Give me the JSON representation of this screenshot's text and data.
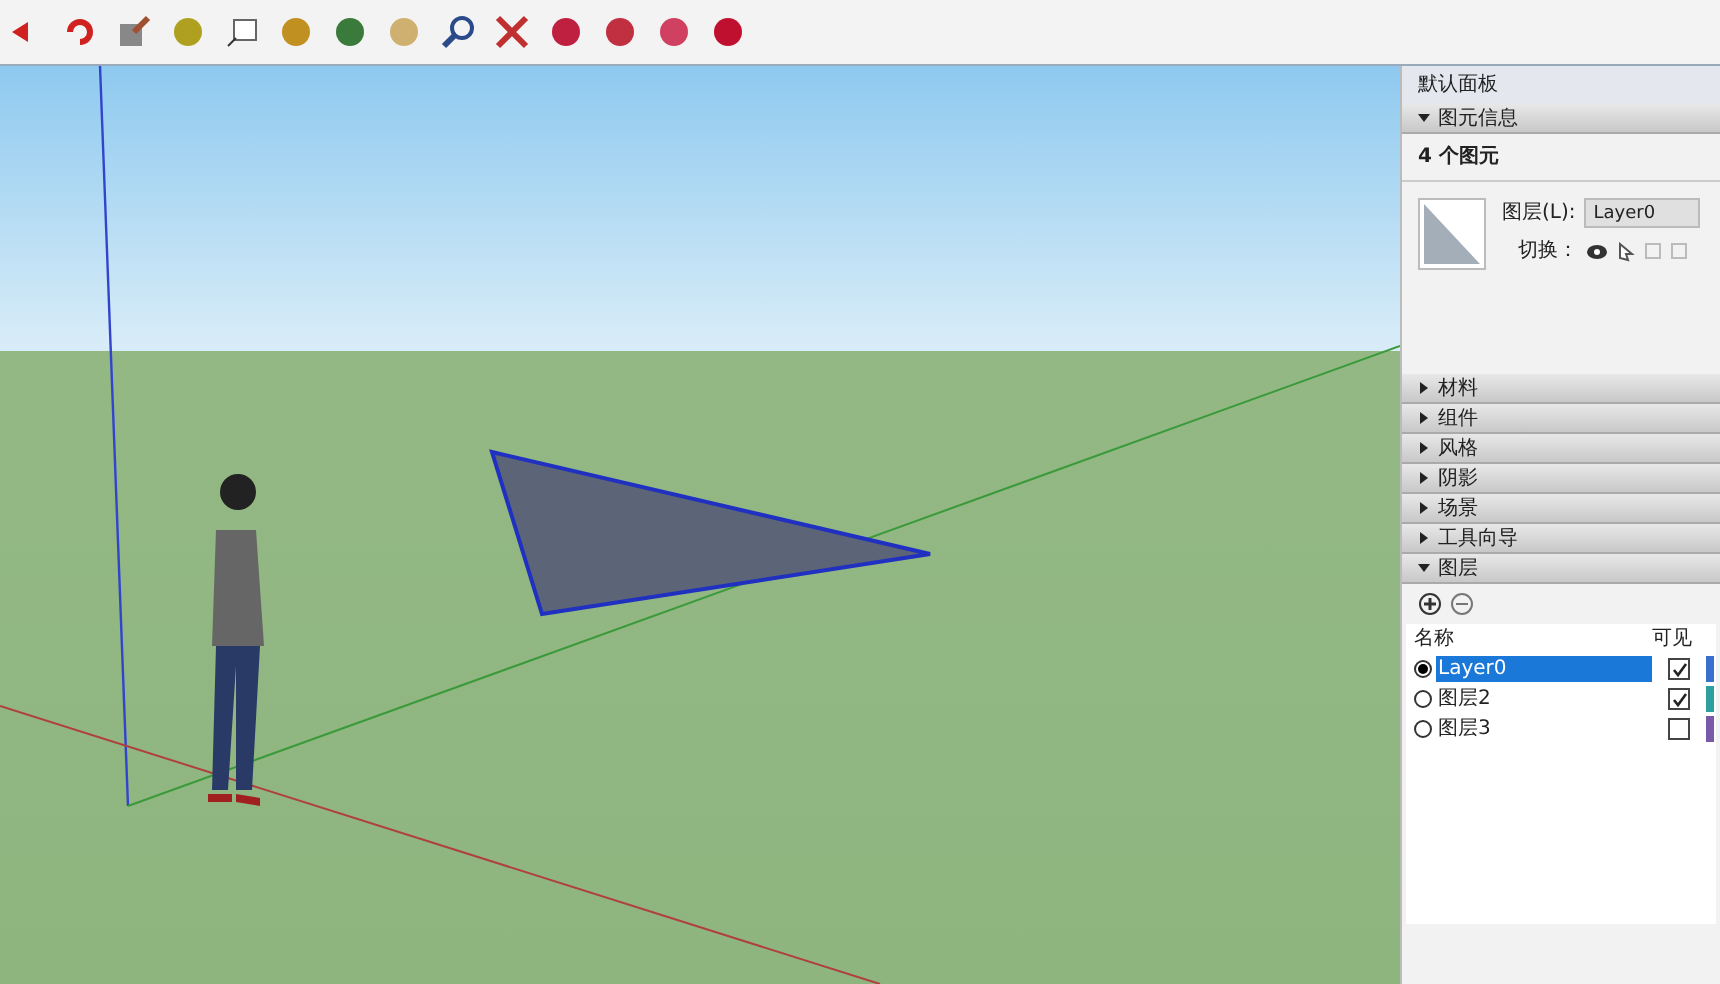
{
  "panel": {
    "title": "默认面板",
    "entity_info": {
      "title": "图元信息",
      "expanded": true,
      "count": "4 个图元",
      "layer_label": "图层(L):",
      "layer_value": "Layer0",
      "toggle_label": "切换："
    },
    "sections": [
      {
        "title": "材料",
        "expanded": false
      },
      {
        "title": "组件",
        "expanded": false
      },
      {
        "title": "风格",
        "expanded": false
      },
      {
        "title": "阴影",
        "expanded": false
      },
      {
        "title": "场景",
        "expanded": false
      },
      {
        "title": "工具向导",
        "expanded": false
      },
      {
        "title": "图层",
        "expanded": true
      }
    ],
    "layers": {
      "columns": [
        "名称",
        "可见"
      ],
      "rows": [
        {
          "name": "Layer0",
          "selected": true,
          "visible": true,
          "color": "#3a6fd0"
        },
        {
          "name": "图层2",
          "selected": false,
          "visible": true,
          "color": "#2e9fa0"
        },
        {
          "name": "图层3",
          "selected": false,
          "visible": false,
          "color": "#7a5aa8"
        }
      ]
    }
  }
}
